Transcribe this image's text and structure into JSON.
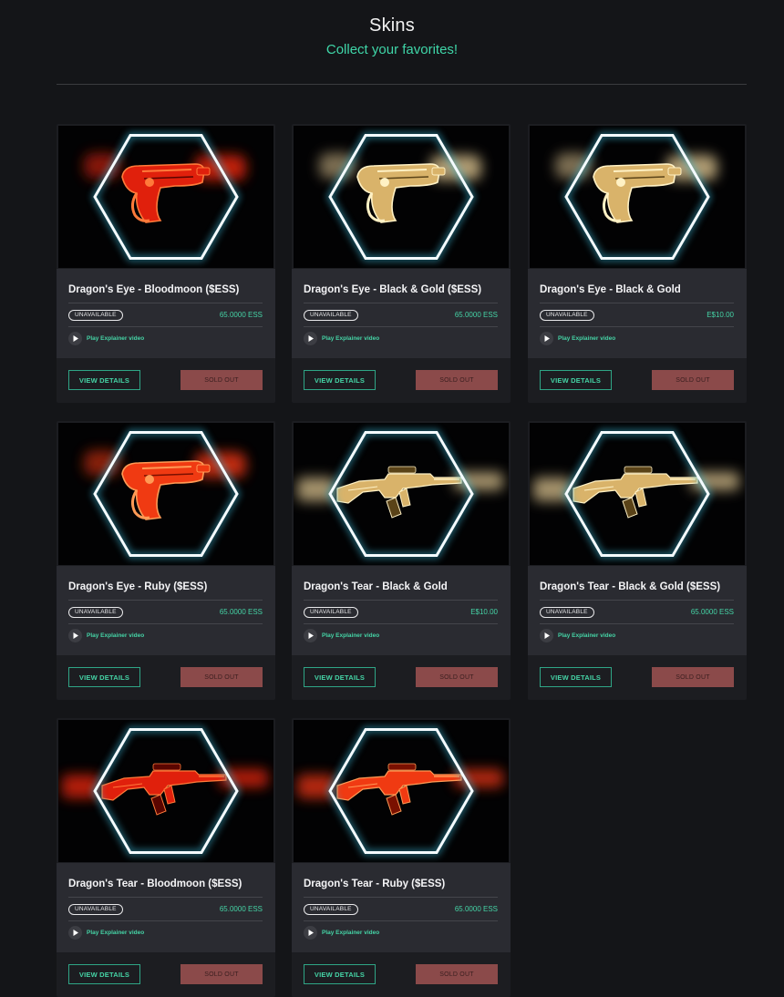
{
  "header": {
    "title": "Skins",
    "subtitle": "Collect your favorites!"
  },
  "products": [
    {
      "name": "Dragon's Eye - Bloodmoon ($ESS)",
      "status": "UNAVAILABLE",
      "price": "65.0000 ESS",
      "video_label": "Play Explainer video",
      "details_label": "VIEW DETAILS",
      "action_label": "SOLD OUT",
      "weapon": "pistol",
      "finish": "red"
    },
    {
      "name": "Dragon's Eye - Black & Gold ($ESS)",
      "status": "UNAVAILABLE",
      "price": "65.0000 ESS",
      "video_label": "Play Explainer video",
      "details_label": "VIEW DETAILS",
      "action_label": "SOLD OUT",
      "weapon": "pistol",
      "finish": "gold"
    },
    {
      "name": "Dragon's Eye - Black & Gold",
      "status": "UNAVAILABLE",
      "price": "E$10.00",
      "video_label": "Play Explainer video",
      "details_label": "VIEW DETAILS",
      "action_label": "SOLD OUT",
      "weapon": "pistol",
      "finish": "gold"
    },
    {
      "name": "Dragon's Eye - Ruby ($ESS)",
      "status": "UNAVAILABLE",
      "price": "65.0000 ESS",
      "video_label": "Play Explainer video",
      "details_label": "VIEW DETAILS",
      "action_label": "SOLD OUT",
      "weapon": "pistol",
      "finish": "ruby"
    },
    {
      "name": "Dragon's Tear - Black & Gold",
      "status": "UNAVAILABLE",
      "price": "E$10.00",
      "video_label": "Play Explainer video",
      "details_label": "VIEW DETAILS",
      "action_label": "SOLD OUT",
      "weapon": "rifle",
      "finish": "gold"
    },
    {
      "name": "Dragon's Tear - Black & Gold ($ESS)",
      "status": "UNAVAILABLE",
      "price": "65.0000 ESS",
      "video_label": "Play Explainer video",
      "details_label": "VIEW DETAILS",
      "action_label": "SOLD OUT",
      "weapon": "rifle",
      "finish": "gold"
    },
    {
      "name": "Dragon's Tear - Bloodmoon ($ESS)",
      "status": "UNAVAILABLE",
      "price": "65.0000 ESS",
      "video_label": "Play Explainer video",
      "details_label": "VIEW DETAILS",
      "action_label": "SOLD OUT",
      "weapon": "rifle",
      "finish": "red"
    },
    {
      "name": "Dragon's Tear - Ruby ($ESS)",
      "status": "UNAVAILABLE",
      "price": "65.0000 ESS",
      "video_label": "Play Explainer video",
      "details_label": "VIEW DETAILS",
      "action_label": "SOLD OUT",
      "weapon": "rifle",
      "finish": "ruby"
    }
  ],
  "colors": {
    "accent": "#45d4a6",
    "sold_out": "#8b4a4a",
    "card_info_bg": "#2a2b31",
    "page_bg": "#141518"
  },
  "icons": {
    "play": "play-icon",
    "frame": "hexagon-frame"
  }
}
